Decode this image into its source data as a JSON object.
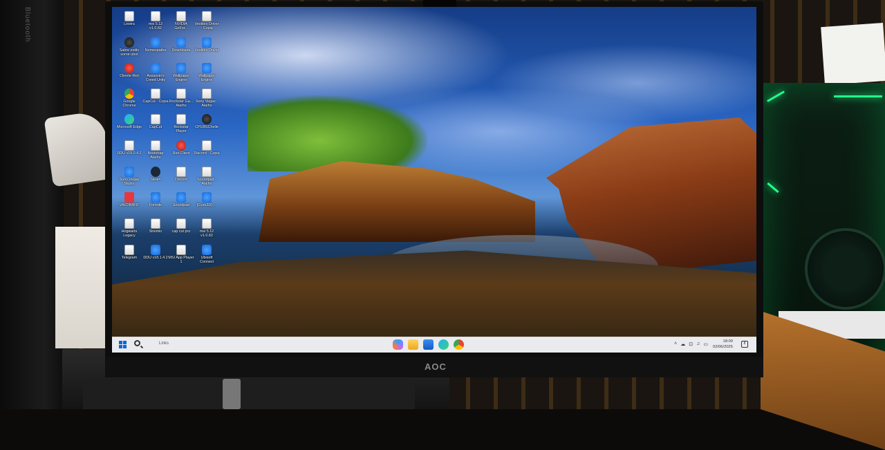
{
  "monitor": {
    "brand": "AOC"
  },
  "speaker_brand": "Bluetooth",
  "desktop": {
    "icons": [
      {
        "label": "Lixeira",
        "icon": "recycle-bin-icon",
        "style": "file"
      },
      {
        "label": "msi 5.12 v1.0.82",
        "icon": "file-icon",
        "style": "file"
      },
      {
        "label": "NVIDIA GeFor...",
        "icon": "file-icon",
        "style": "file"
      },
      {
        "label": "Vestibio Driver - Copia",
        "icon": "file-icon",
        "style": "file"
      },
      {
        "label": "Sabre estilo sorne ubot",
        "icon": "app-icon",
        "style": "app-dark"
      },
      {
        "label": "Nomespatha",
        "icon": "shortcut-icon",
        "style": "shortcut"
      },
      {
        "label": "Downloads",
        "icon": "shortcut-icon",
        "style": "shortcut"
      },
      {
        "label": "Vestibio Driver",
        "icon": "shortcut-icon",
        "style": "shortcut"
      },
      {
        "label": "Cliente Riot",
        "icon": "riot-icon",
        "style": "app-red"
      },
      {
        "label": "Assassin's Creed Unity",
        "icon": "game-icon",
        "style": "shortcut"
      },
      {
        "label": "Wallpaper Engine",
        "icon": "shortcut-icon",
        "style": "shortcut"
      },
      {
        "label": "Wallpaper Engine",
        "icon": "shortcut-icon",
        "style": "shortcut"
      },
      {
        "label": "Google Chrome",
        "icon": "chrome-icon",
        "style": "app-chrome"
      },
      {
        "label": "CapCut - Copia",
        "icon": "file-icon",
        "style": "file"
      },
      {
        "label": "Rockstar Ga... Atalho",
        "icon": "file-icon",
        "style": "file"
      },
      {
        "label": "Sony Vegas - Atalho",
        "icon": "file-icon",
        "style": "file"
      },
      {
        "label": "Microsoft Edge",
        "icon": "edge-icon",
        "style": "app-edge"
      },
      {
        "label": "CapCut",
        "icon": "file-icon",
        "style": "file"
      },
      {
        "label": "Rockstar Player",
        "icon": "file-icon",
        "style": "file"
      },
      {
        "label": "CPUBSChelle",
        "icon": "app-icon",
        "style": "app-dark"
      },
      {
        "label": "DDU v18.0.4.2",
        "icon": "file-icon",
        "style": "file"
      },
      {
        "label": "Bootstrap Atalho",
        "icon": "file-icon",
        "style": "file"
      },
      {
        "label": "Riot Client",
        "icon": "riot-icon",
        "style": "app-red"
      },
      {
        "label": "Discord - Copia",
        "icon": "file-icon",
        "style": "file"
      },
      {
        "label": "Sony Vegas Studio",
        "icon": "shortcut-icon",
        "style": "shortcut"
      },
      {
        "label": "Steam",
        "icon": "steam-icon",
        "style": "app-steam"
      },
      {
        "label": "Discord",
        "icon": "file-icon",
        "style": "file"
      },
      {
        "label": "Soundpad - Atalho",
        "icon": "file-icon",
        "style": "file"
      },
      {
        "label": "VALORANT",
        "icon": "valorant-icon",
        "style": "app-valorant"
      },
      {
        "label": "Fortnite",
        "icon": "shortcut-icon",
        "style": "shortcut"
      },
      {
        "label": "Soundpad",
        "icon": "shortcut-icon",
        "style": "shortcut"
      },
      {
        "label": "[Guru3D]-...",
        "icon": "shortcut-icon",
        "style": "shortcut"
      },
      {
        "label": "Hogwarts Legacy",
        "icon": "file-icon",
        "style": "file"
      },
      {
        "label": "Stremio",
        "icon": "file-icon",
        "style": "file"
      },
      {
        "label": "cap cut pro",
        "icon": "file-icon",
        "style": "file"
      },
      {
        "label": "msi 5.12 v1.0.82",
        "icon": "file-icon",
        "style": "file"
      },
      {
        "label": "Telegram",
        "icon": "file-icon",
        "style": "file"
      },
      {
        "label": "DDU v18.1.4.2",
        "icon": "shortcut-icon",
        "style": "shortcut"
      },
      {
        "label": "MSI App Player 1",
        "icon": "file-icon",
        "style": "file"
      },
      {
        "label": "Ubisoft Connect",
        "icon": "shortcut-icon",
        "style": "shortcut"
      }
    ]
  },
  "taskbar": {
    "search_text": "Links",
    "time": "18:00",
    "date": "02/06/2025",
    "notification_count": "8",
    "pinned": [
      "copilot-icon",
      "file-explorer-icon",
      "store-icon",
      "edge-icon",
      "chrome-icon"
    ],
    "tray": [
      "chevron-up-icon",
      "cloud-icon",
      "network-icon",
      "speaker-icon",
      "battery-icon"
    ],
    "tray_glyphs": [
      "˄",
      "☁",
      "⊡",
      "♫",
      "▭"
    ]
  },
  "colors": {
    "accent": "#0a66d6",
    "taskbar_bg": "#f0f2f6"
  }
}
